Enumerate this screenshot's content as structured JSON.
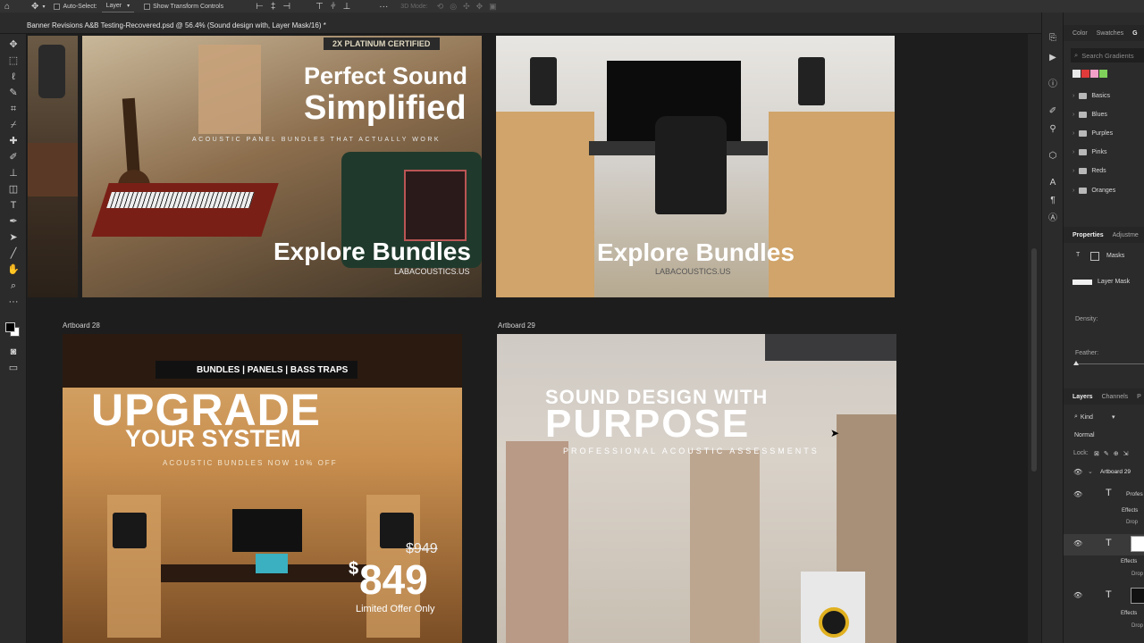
{
  "options_bar": {
    "auto_select_label": "Auto-Select:",
    "auto_select_value": "Layer",
    "show_transform_label": "Show Transform Controls",
    "mode_3d_label": "3D Mode:"
  },
  "document": {
    "tab_title": "Banner Revisions A&B Testing-Recovered.psd @ 56.4% (Sound design with, Layer Mask/16) *"
  },
  "artboards": {
    "a1": {
      "badge": "2X PLATINUM CERTIFIED",
      "headline_1": "Perfect Sound",
      "headline_2": "Simplified",
      "tagline": "ACOUSTIC PANEL BUNDLES THAT ACTUALLY WORK",
      "cta": "Explore Bundles",
      "url": "LABACOUSTICS.US"
    },
    "a2": {
      "cta": "Explore Bundles",
      "url": "LABACOUSTICS.US"
    },
    "a3": {
      "label": "Artboard 28",
      "category_bar": "BUNDLES | PANELS | BASS TRAPS",
      "headline_1": "UPGRADE",
      "headline_2": "YOUR SYSTEM",
      "tagline": "ACOUSTIC BUNDLES NOW 10% OFF",
      "old_price": "$949",
      "price_symbol": "$",
      "price": "849",
      "offer": "Limited Offer Only"
    },
    "a4": {
      "label": "Artboard 29",
      "headline_1": "SOUND DESIGN WITH",
      "headline_2": "PURPOSE",
      "tagline": "PROFESSIONAL ACOUSTIC ASSESSMENTS"
    }
  },
  "panels": {
    "top_tabs": [
      "Color",
      "Swatches",
      "G"
    ],
    "search_placeholder": "Search Gradients",
    "gradient_folders": [
      "Basics",
      "Blues",
      "Purples",
      "Pinks",
      "Reds",
      "Oranges"
    ],
    "gradient_swatch_colors": [
      "#e8e8e8",
      "#e03a3a",
      "#f2a0c8",
      "#7fd05a"
    ],
    "properties_tabs": [
      "Properties",
      "Adjustme"
    ],
    "masks_label": "Masks",
    "layer_mask_label": "Layer Mask",
    "density_label": "Density:",
    "feather_label": "Feather:",
    "layers_tabs": [
      "Layers",
      "Channels",
      "P"
    ],
    "kind_label": "Kind",
    "blend_mode": "Normal",
    "lock_label": "Lock:",
    "artboard_layer": "Artboard 29",
    "text_layer_1": "Profes",
    "effects_label": "Effects",
    "drop_label": "Drop"
  }
}
